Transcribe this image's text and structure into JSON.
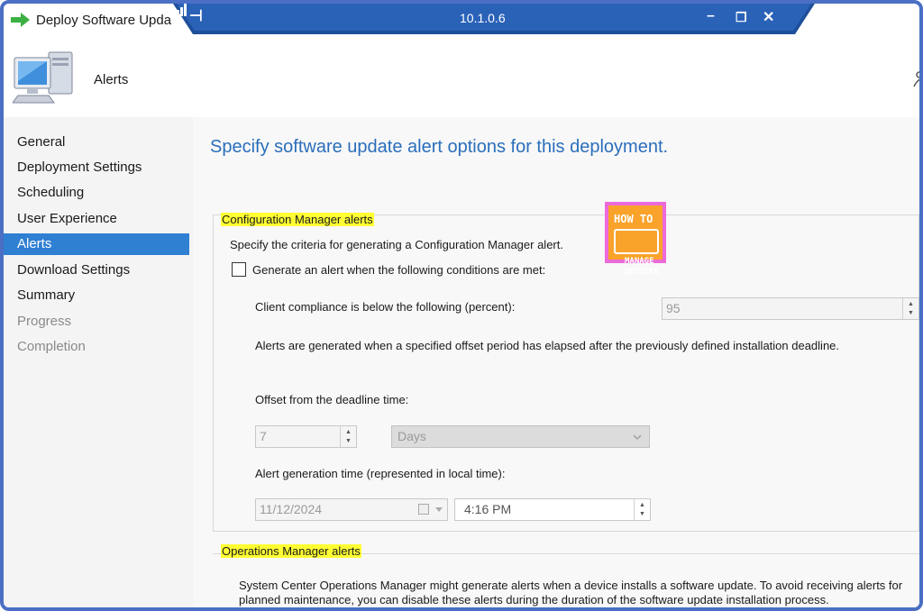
{
  "window": {
    "title": "Deploy Software Upda",
    "remote": {
      "ip": "10.1.0.6",
      "pin_icon": "pin-icon",
      "signal_icon": "signal-icon"
    }
  },
  "header": {
    "title": "Alerts"
  },
  "sidebar": {
    "items": [
      {
        "label": "General",
        "state": "normal"
      },
      {
        "label": "Deployment Settings",
        "state": "normal"
      },
      {
        "label": "Scheduling",
        "state": "normal"
      },
      {
        "label": "User Experience",
        "state": "normal"
      },
      {
        "label": "Alerts",
        "state": "active"
      },
      {
        "label": "Download Settings",
        "state": "normal"
      },
      {
        "label": "Summary",
        "state": "normal"
      },
      {
        "label": "Progress",
        "state": "disabled"
      },
      {
        "label": "Completion",
        "state": "disabled"
      }
    ]
  },
  "main": {
    "heading": "Specify software update alert options for this deployment.",
    "cm_group": {
      "label": "Configuration Manager alerts",
      "description": "Specify the criteria for generating a Configuration Manager alert.",
      "checkbox_label": "Generate an alert when the following conditions are met:",
      "checkbox_checked": false,
      "compliance_label": "Client compliance is below the following (percent):",
      "compliance_value": "95",
      "info": "Alerts are generated when a specified offset period has elapsed after the previously defined installation deadline.",
      "offset_label": "Offset from the deadline time:",
      "offset_value": "7",
      "offset_unit": "Days",
      "generation_label": "Alert generation time (represented in local time):",
      "date_value": "11/12/2024",
      "time_value": "4:16 PM"
    },
    "om_group": {
      "label": "Operations Manager alerts",
      "description": "System Center Operations Manager might generate alerts when a device installs a software update. To avoid receiving alerts for planned maintenance, you can disable these alerts during the duration of the software update installation process."
    }
  },
  "logo": {
    "line1": "HOW TO",
    "line2a": "MANAGE",
    "line2b": "DEVICES"
  },
  "colors": {
    "accent": "#2f7fd3",
    "heading": "#2a6ebb",
    "highlight": "#ffff33",
    "frame": "#4a6fc4"
  }
}
